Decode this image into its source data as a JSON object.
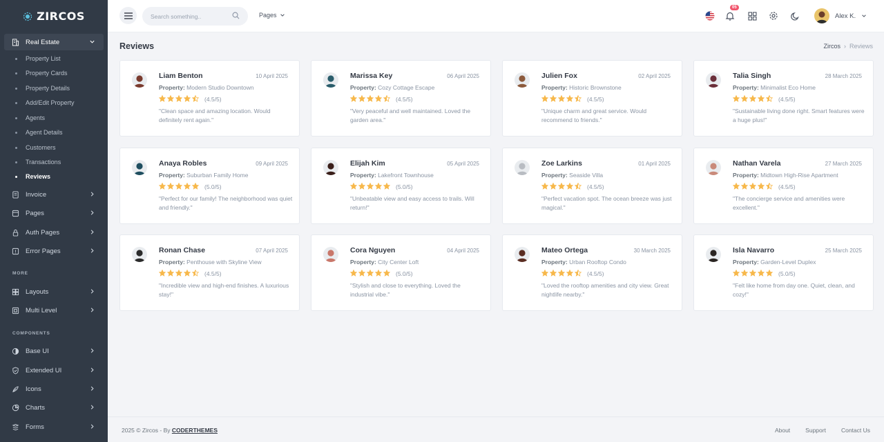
{
  "brand": {
    "name": "ZIRCOS"
  },
  "sidebar": {
    "real_estate": "Real Estate",
    "sub_items": [
      "Property List",
      "Property Cards",
      "Property Details",
      "Add/Edit Property",
      "Agents",
      "Agent Details",
      "Customers",
      "Transactions",
      "Reviews"
    ],
    "active_sub": "Reviews",
    "groups": [
      "Invoice",
      "Pages",
      "Auth Pages",
      "Error Pages"
    ],
    "more_title": "MORE",
    "more_items": [
      "Layouts",
      "Multi Level"
    ],
    "components_title": "COMPONENTS",
    "component_items": [
      "Base UI",
      "Extended UI",
      "Icons",
      "Charts",
      "Forms"
    ]
  },
  "topbar": {
    "search_placeholder": "Search something..",
    "pages_label": "Pages",
    "notification_count": "05",
    "user_name": "Alex K."
  },
  "page": {
    "title": "Reviews",
    "breadcrumb": [
      "Zircos",
      "Reviews"
    ]
  },
  "reviews": [
    {
      "name": "Liam Benton",
      "date": "10 April 2025",
      "property": "Modern Studio Downtown",
      "rating": 4.5,
      "rating_text": "(4.5/5)",
      "text": "\"Clean space and amazing location. Would definitely rent again.\"",
      "avatar_color": "#7a3b2e"
    },
    {
      "name": "Marissa Key",
      "date": "06 April 2025",
      "property": "Cozy Cottage Escape",
      "rating": 4.5,
      "rating_text": "(4.5/5)",
      "text": "\"Very peaceful and well maintained. Loved the garden area.\"",
      "avatar_color": "#2a5d6b"
    },
    {
      "name": "Julien Fox",
      "date": "02 April 2025",
      "property": "Historic Brownstone",
      "rating": 4.5,
      "rating_text": "(4.5/5)",
      "text": "\"Unique charm and great service. Would recommend to friends.\"",
      "avatar_color": "#8c5a3c"
    },
    {
      "name": "Talia Singh",
      "date": "28 March 2025",
      "property": "Minimalist Eco Home",
      "rating": 4.5,
      "rating_text": "(4.5/5)",
      "text": "\"Sustainable living done right. Smart features were a huge plus!\"",
      "avatar_color": "#6b2f3a"
    },
    {
      "name": "Anaya Robles",
      "date": "09 April 2025",
      "property": "Suburban Family Home",
      "rating": 5,
      "rating_text": "(5.0/5)",
      "text": "\"Perfect for our family! The neighborhood was quiet and friendly.\"",
      "avatar_color": "#1f4e5f"
    },
    {
      "name": "Elijah Kim",
      "date": "05 April 2025",
      "property": "Lakefront Townhouse",
      "rating": 5,
      "rating_text": "(5.0/5)",
      "text": "\"Unbeatable view and easy access to trails. Will return!\"",
      "avatar_color": "#3a1f1a"
    },
    {
      "name": "Zoe Larkins",
      "date": "01 April 2025",
      "property": "Seaside Villa",
      "rating": 4.5,
      "rating_text": "(4.5/5)",
      "text": "\"Perfect vacation spot. The ocean breeze was just magical.\"",
      "avatar_color": "#b8bcc2"
    },
    {
      "name": "Nathan Varela",
      "date": "27 March 2025",
      "property": "Midtown High-Rise Apartment",
      "rating": 4.5,
      "rating_text": "(4.5/5)",
      "text": "\"The concierge service and amenities were excellent.\"",
      "avatar_color": "#c98a7a"
    },
    {
      "name": "Ronan Chase",
      "date": "07 April 2025",
      "property": "Penthouse with Skyline View",
      "rating": 4.5,
      "rating_text": "(4.5/5)",
      "text": "\"Incredible view and high-end finishes. A luxurious stay!\"",
      "avatar_color": "#2b2b2b"
    },
    {
      "name": "Cora Nguyen",
      "date": "04 April 2025",
      "property": "City Center Loft",
      "rating": 5,
      "rating_text": "(5.0/5)",
      "text": "\"Stylish and close to everything. Loved the industrial vibe.\"",
      "avatar_color": "#c9776a"
    },
    {
      "name": "Mateo Ortega",
      "date": "30 March 2025",
      "property": "Urban Rooftop Condo",
      "rating": 4.5,
      "rating_text": "(4.5/5)",
      "text": "\"Loved the rooftop amenities and city view. Great nightlife nearby.\"",
      "avatar_color": "#5a2d22"
    },
    {
      "name": "Isla Navarro",
      "date": "25 March 2025",
      "property": "Garden-Level Duplex",
      "rating": 5,
      "rating_text": "(5.0/5)",
      "text": "\"Felt like home from day one. Quiet, clean, and cozy!\"",
      "avatar_color": "#2a2522"
    }
  ],
  "property_label": "Property:",
  "footer": {
    "copyright": "2025 © Zircos - By ",
    "brand": "CODERTHEMES",
    "links": [
      "About",
      "Support",
      "Contact Us"
    ]
  },
  "colors": {
    "sidebar_bg": "#313a46",
    "star": "#f7b84b",
    "badge": "#f1556c",
    "brand_accent": "#5bc0de"
  }
}
